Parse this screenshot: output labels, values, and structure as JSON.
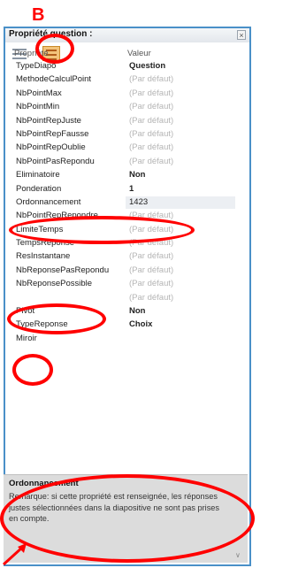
{
  "annotation": {
    "label": "B",
    "color": "#ff0000"
  },
  "panel": {
    "title": "Propriété question :",
    "close_icon": "×",
    "toolbar_icons": [
      "list-view-icon",
      "categorized-view-icon"
    ]
  },
  "grid": {
    "headers": {
      "property": "Propriété",
      "value": "Valeur"
    },
    "rows": [
      {
        "name": "TypeDiapo",
        "value": "Question",
        "style": "bold"
      },
      {
        "name": "MethodeCalculPoint",
        "value": "(Par défaut)",
        "style": "default"
      },
      {
        "name": "NbPointMax",
        "value": "(Par défaut)",
        "style": "default"
      },
      {
        "name": "NbPointMin",
        "value": "(Par défaut)",
        "style": "default"
      },
      {
        "name": "NbPointRepJuste",
        "value": "(Par défaut)",
        "style": "default"
      },
      {
        "name": "NbPointRepFausse",
        "value": "(Par défaut)",
        "style": "default"
      },
      {
        "name": "NbPointRepOublie",
        "value": "(Par défaut)",
        "style": "default"
      },
      {
        "name": "NbPointPasRepondu",
        "value": "(Par défaut)",
        "style": "default"
      },
      {
        "name": "Eliminatoire",
        "value": "Non",
        "style": "bold"
      },
      {
        "name": "Ponderation",
        "value": "1",
        "style": "bold"
      },
      {
        "name": "Ordonnancement",
        "value": "1423",
        "style": "selected"
      },
      {
        "name": "NbPointRepRepondre",
        "value": "(Par défaut)",
        "style": "default"
      },
      {
        "name": "LimiteTemps",
        "value": "(Par défaut)",
        "style": "default"
      },
      {
        "name": "TempsReponse",
        "value": "(Par défaut)",
        "style": "default"
      },
      {
        "name": "ResInstantane",
        "value": "(Par défaut)",
        "style": "default"
      },
      {
        "name": "NbReponsePasRepondu",
        "value": "(Par défaut)",
        "style": "default"
      },
      {
        "name": "NbReponsePossible",
        "value": "(Par défaut)",
        "style": "default"
      },
      {
        "name": "",
        "value": "(Par défaut)",
        "style": "default"
      },
      {
        "name": "Pivot",
        "value": "Non",
        "style": "bold"
      },
      {
        "name": "TypeReponse",
        "value": "Choix",
        "style": "bold"
      },
      {
        "name": "Miroir",
        "value": "",
        "style": "default"
      }
    ]
  },
  "description": {
    "title": "Ordonnancement",
    "text": "Remarque: si cette propriété est renseignée, les réponses justes sélectionnées dans la diapositive ne sont pas prises en compte."
  }
}
